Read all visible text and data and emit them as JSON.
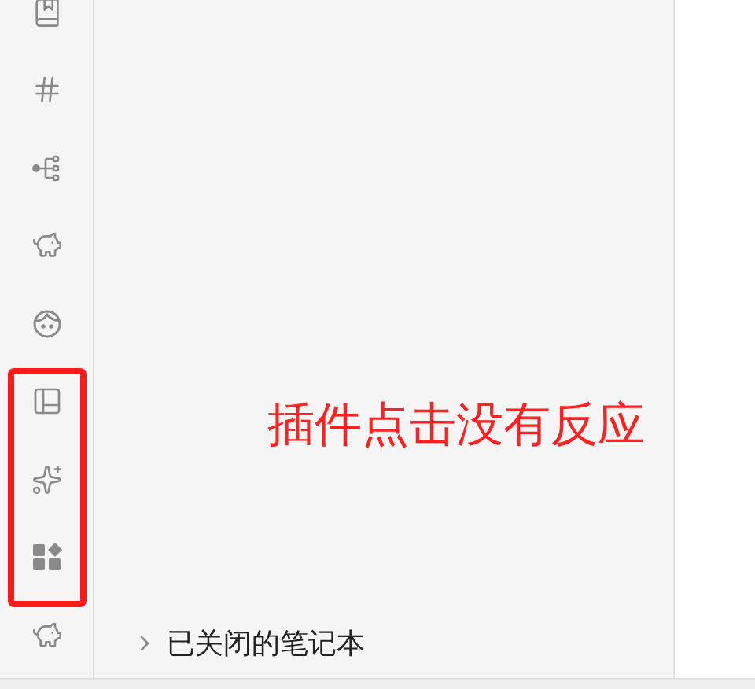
{
  "panel": {
    "closed_notebooks": {
      "label": "已关闭的笔记本",
      "expanded": false
    }
  },
  "annotation": {
    "text": "插件点击没有反应"
  }
}
